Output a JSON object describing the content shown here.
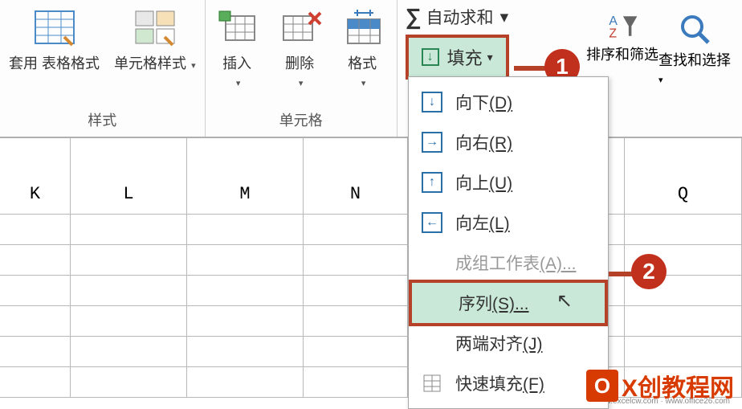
{
  "ribbon": {
    "styles_group": {
      "table_format": "套用\n表格格式",
      "cell_styles": "单元格样式",
      "label": "样式"
    },
    "cells_group": {
      "insert": "插入",
      "delete": "删除",
      "format": "格式",
      "label": "单元格"
    },
    "editing_group": {
      "autosum": "自动求和",
      "fill": "填充",
      "sort_filter": "排序和筛选",
      "find_select": "查找和选择"
    }
  },
  "menu": {
    "down": "向下",
    "down_key": "(D)",
    "right": "向右",
    "right_key": "(R)",
    "up": "向上",
    "up_key": "(U)",
    "left": "向左",
    "left_key": "(L)",
    "across": "成组工作表",
    "across_key": "(A)...",
    "series": "序列",
    "series_key": "(S)...",
    "justify": "两端对齐",
    "justify_key": "(J)",
    "flash": "快速填充",
    "flash_key": "(F)"
  },
  "columns": {
    "k": "K",
    "l": "L",
    "m": "M",
    "n": "N",
    "q": "Q"
  },
  "callouts": {
    "one": "1",
    "two": "2"
  },
  "watermark": {
    "text": "X创教程网",
    "url1": "https://www.excelcw.com",
    "url2": "www.office26.com"
  }
}
